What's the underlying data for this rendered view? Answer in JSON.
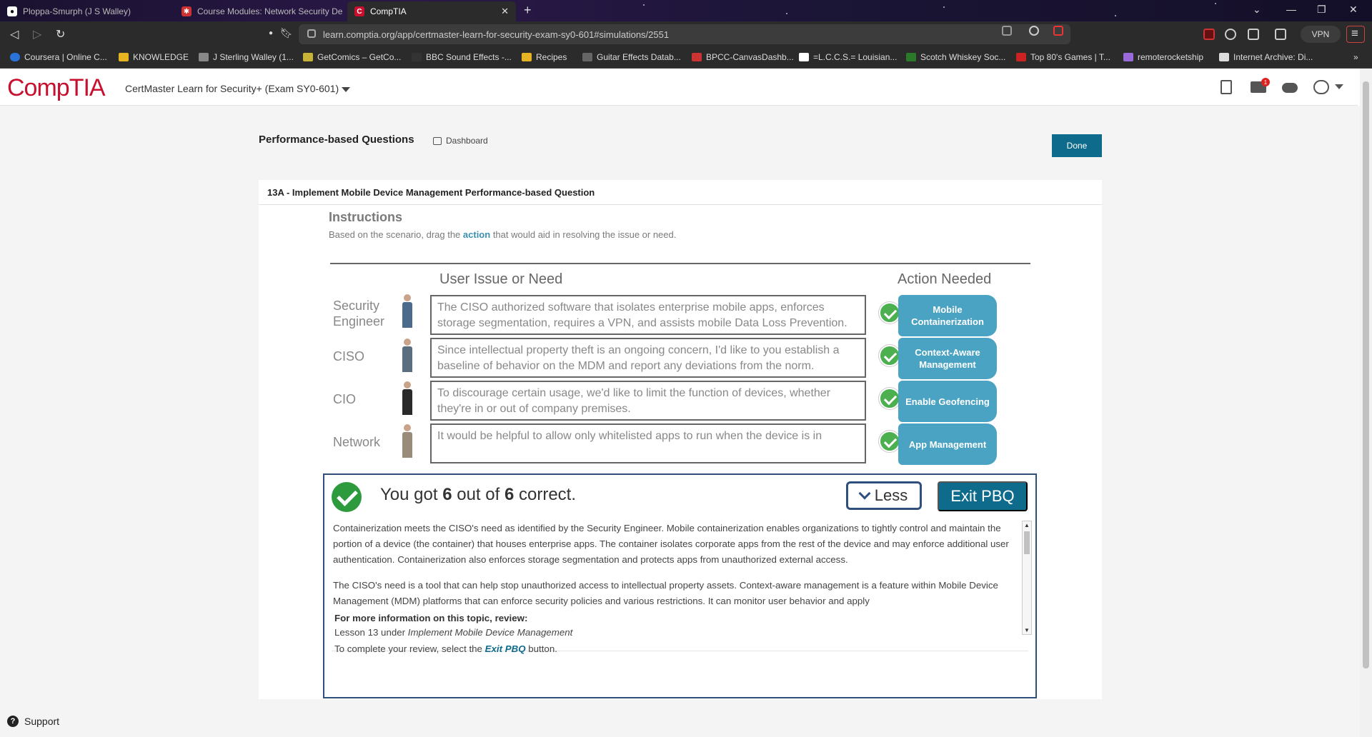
{
  "browser": {
    "tabs": [
      {
        "title": "Ploppa-Smurph (J S Walley)",
        "icon": "github-icon"
      },
      {
        "title": "Course Modules: Network Security De",
        "icon": "canvas-icon"
      },
      {
        "title": "CompTIA",
        "icon": "comptia-icon",
        "active": true
      }
    ],
    "url": "learn.comptia.org/app/certmaster-learn-for-security-exam-sy0-601#simulations/2551",
    "vpn_label": "VPN",
    "bookmarks": [
      "Coursera | Online C...",
      "KNOWLEDGE",
      "J Sterling Walley (1...",
      "GetComics – GetCo...",
      "BBC Sound Effects -...",
      "Recipes",
      "Guitar Effects Datab...",
      "BPCC-CanvasDashb...",
      "=L.C.C.S.= Louisian...",
      "Scotch Whiskey Soc...",
      "Top 80's Games | T...",
      "remoterocketship",
      "Internet Archive: Di..."
    ]
  },
  "header": {
    "logo": "CompTIA",
    "course_title": "CertMaster Learn for Security+ (Exam SY0-601)",
    "notification_count": "1"
  },
  "page": {
    "section_title": "Performance-based Questions",
    "dashboard_label": "Dashboard",
    "done_label": "Done",
    "question_title": "13A - Implement Mobile Device Management Performance-based Question",
    "instructions_heading": "Instructions",
    "instructions_prefix": "Based on the scenario, drag the ",
    "instructions_keyword": "action",
    "instructions_suffix": " that would aid in resolving the issue or need.",
    "col_issue": "User Issue or Need",
    "col_action": "Action Needed"
  },
  "rows": [
    {
      "role": "Security Engineer",
      "issue": "The CISO authorized software that isolates enterprise mobile apps, enforces storage segmentation, requires a VPN, and assists mobile Data Loss Prevention.",
      "action": "Mobile Containerization",
      "person_color": "#4b6a8c"
    },
    {
      "role": "CISO",
      "issue": "Since intellectual property theft is an ongoing concern, I'd like to you establish a baseline of behavior on the MDM and report any deviations from the norm.",
      "action": "Context-Aware Management",
      "person_color": "#5a6e80"
    },
    {
      "role": "CIO",
      "issue": "To discourage certain usage, we'd like to limit the function of devices, whether they're in or out of company premises.",
      "action": "Enable Geofencing",
      "person_color": "#2a2a2a"
    },
    {
      "role": "Network",
      "issue": "It would be helpful to allow only whitelisted apps to run when the device is in",
      "action": "App Management",
      "person_color": "#9a8a7a"
    }
  ],
  "result": {
    "score_prefix": "You got ",
    "score_correct": "6",
    "score_mid": " out of ",
    "score_total": "6",
    "score_suffix": " correct.",
    "less_label": "Less",
    "exit_label": "Exit PBQ",
    "paragraphs": [
      "Containerization meets the CISO's need as identified by the Security Engineer. Mobile containerization enables organizations to tightly control and maintain the portion of a device (the container) that houses enterprise apps. The container isolates corporate apps from the rest of the device and may enforce additional user authentication. Containerization also enforces storage segmentation and protects apps from unauthorized external access.",
      "The CISO's need is a tool that can help stop unauthorized access to intellectual property assets. Context-aware management is a feature within Mobile Device Management (MDM) platforms that can enforce security policies and various restrictions. It can monitor user behavior and apply"
    ],
    "more_heading": "For more information on this topic, review:",
    "more_prefix": "Lesson 13 under ",
    "more_topic": "Implement Mobile Device Management",
    "complete_prefix": "To complete your review, select the ",
    "complete_link": "Exit PBQ",
    "complete_suffix": " button."
  },
  "footer": {
    "support_label": "Support"
  }
}
